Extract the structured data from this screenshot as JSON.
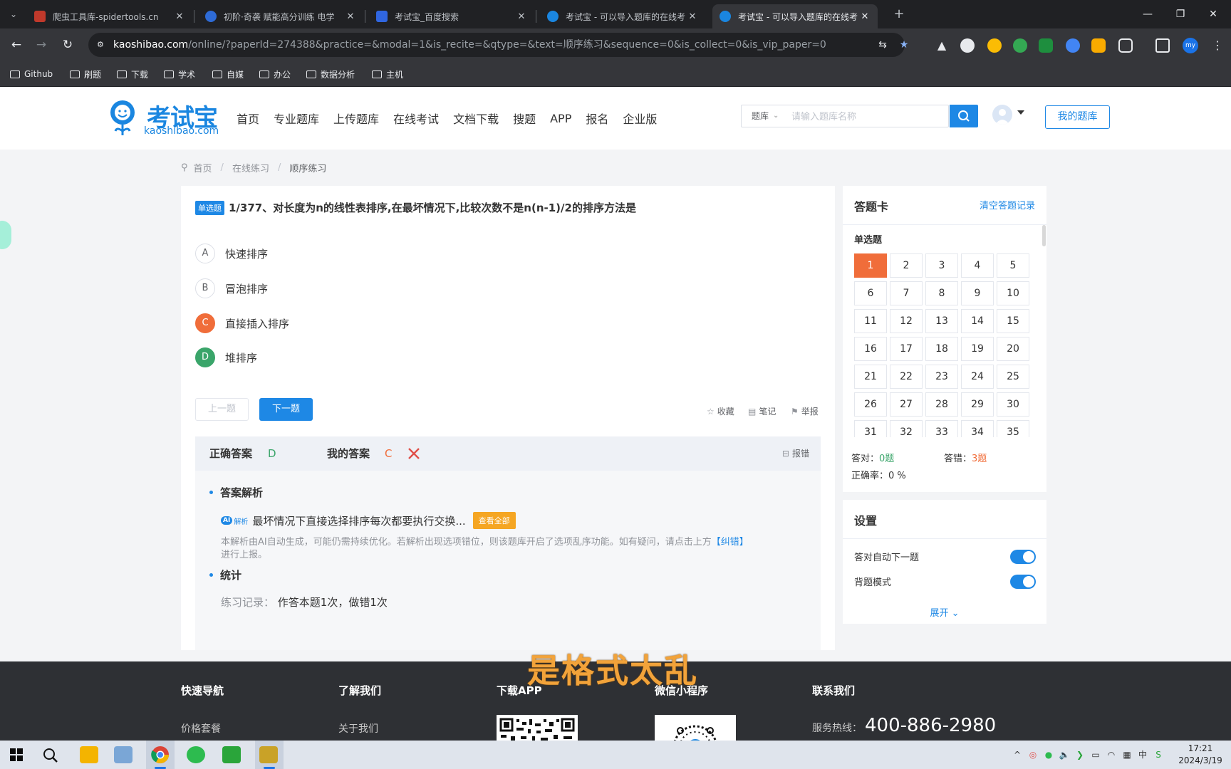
{
  "browser": {
    "tabs": [
      {
        "title": "爬虫工具库-spidertools.cn",
        "color": "#c0392b"
      },
      {
        "title": "初阶·奇袭 赋能高分训练 电学",
        "color": "#2e6bd6"
      },
      {
        "title": "考试宝_百度搜索",
        "color": "#3066e0"
      },
      {
        "title": "考试宝 - 可以导入题库的在线考",
        "color": "#1a86e0"
      },
      {
        "title": "考试宝 - 可以导入题库的在线考",
        "color": "#1a86e0"
      }
    ],
    "url_host": "kaoshibao.com",
    "url_rest": "/online/?paperId=274388&practice=&modal=1&is_recite=&qtype=&text=顺序练习&sequence=0&is_collect=0&is_vip_paper=0",
    "profile_initials": "my",
    "bookmarks": [
      "Github",
      "刷题",
      "下载",
      "学术",
      "自媒",
      "办公",
      "数据分析",
      "主机"
    ]
  },
  "site": {
    "brand": "考试宝",
    "domain": "kaoshibao.com",
    "nav": [
      "首页",
      "专业题库",
      "上传题库",
      "在线考试",
      "文档下载",
      "搜题",
      "APP",
      "报名",
      "企业版"
    ],
    "search_category": "题库",
    "search_placeholder": "请输入题库名称",
    "my_bank": "我的题库"
  },
  "breadcrumb": [
    "首页",
    "在线练习",
    "顺序练习"
  ],
  "question": {
    "type_label": "单选题",
    "title": "1/377、对长度为n的线性表排序,在最坏情况下,比较次数不是n(n-1)/2的排序方法是",
    "options": [
      {
        "key": "A",
        "text": "快速排序",
        "state": ""
      },
      {
        "key": "B",
        "text": "冒泡排序",
        "state": ""
      },
      {
        "key": "C",
        "text": "直接插入排序",
        "state": "wrong"
      },
      {
        "key": "D",
        "text": "堆排序",
        "state": "right"
      }
    ],
    "prev": "上一题",
    "next": "下一题",
    "tools": [
      "收藏",
      "笔记",
      "举报"
    ]
  },
  "answer": {
    "correct_label": "正确答案",
    "correct_value": "D",
    "mine_label": "我的答案",
    "mine_value": "C",
    "report": "报错",
    "analysis_title": "答案解析",
    "ai_badge": "AI",
    "ai_badge_suffix": "解析",
    "ai_text": "最坏情况下直接选择排序每次都要执行交换...",
    "view_all": "查看全部",
    "disclaimer": "本解析由AI自动生成，可能仍需持续优化。若解析出现选项错位，则该题库开启了选项乱序功能。如有疑问，请点击上方",
    "disclaimer_link": "【纠错】",
    "disclaimer_tail": "进行上报。",
    "stats_title": "统计",
    "stats_key": "练习记录：",
    "stats_value": "作答本题1次，做错1次"
  },
  "sheet": {
    "title": "答题卡",
    "clear": "清空答题记录",
    "section": "单选题",
    "numbers": [
      "1",
      "2",
      "3",
      "4",
      "5",
      "6",
      "7",
      "8",
      "9",
      "10",
      "11",
      "12",
      "13",
      "14",
      "15",
      "16",
      "17",
      "18",
      "19",
      "20",
      "21",
      "22",
      "23",
      "24",
      "25",
      "26",
      "27",
      "28",
      "29",
      "30",
      "31",
      "32",
      "33",
      "34",
      "35"
    ],
    "current": 1,
    "correct_label": "答对：",
    "correct_value": "0题",
    "wrong_label": "答错：",
    "wrong_value": "3题",
    "rate_label": "正确率：0 %"
  },
  "settings": {
    "title": "设置",
    "items": [
      {
        "label": "答对自动下一题",
        "on": true
      },
      {
        "label": "背题模式",
        "on": true
      }
    ],
    "expand": "展开"
  },
  "footer": {
    "cols": [
      "快速导航",
      "了解我们",
      "下载APP",
      "微信小程序",
      "联系我们"
    ],
    "links": [
      "价格套餐",
      "关于我们"
    ],
    "hotline_label": "服务热线：",
    "hotline": "400-886-2980"
  },
  "overlay_caption": "是格式太乱",
  "taskbar": {
    "time": "17:21",
    "date": "2024/3/19"
  }
}
